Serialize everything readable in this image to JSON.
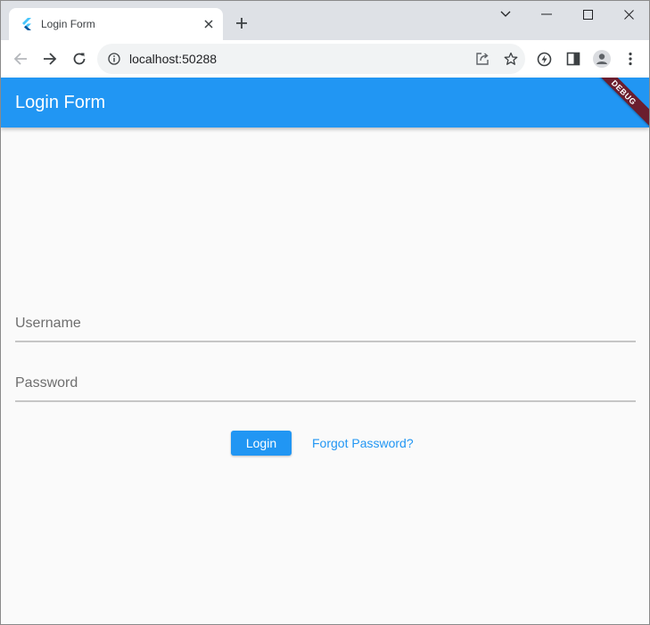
{
  "browser": {
    "tab_title": "Login Form",
    "url": "localhost:50288",
    "icons": {
      "favicon": "flutter-icon",
      "tab_close": "close-icon",
      "new_tab": "plus-icon",
      "back": "back-arrow-icon",
      "forward": "forward-arrow-icon",
      "reload": "reload-icon",
      "site_info": "info-icon",
      "share": "share-icon",
      "bookmark": "star-icon",
      "extensions": "extension-icon",
      "side_panel": "side-panel-icon",
      "profile": "profile-icon",
      "menu": "kebab-menu-icon"
    }
  },
  "app": {
    "title": "Login Form",
    "debug_banner": "DEBUG",
    "accent_color": "#2196f3"
  },
  "form": {
    "username_placeholder": "Username",
    "username_value": "",
    "password_placeholder": "Password",
    "password_value": "",
    "login_label": "Login",
    "forgot_label": "Forgot Password?"
  }
}
